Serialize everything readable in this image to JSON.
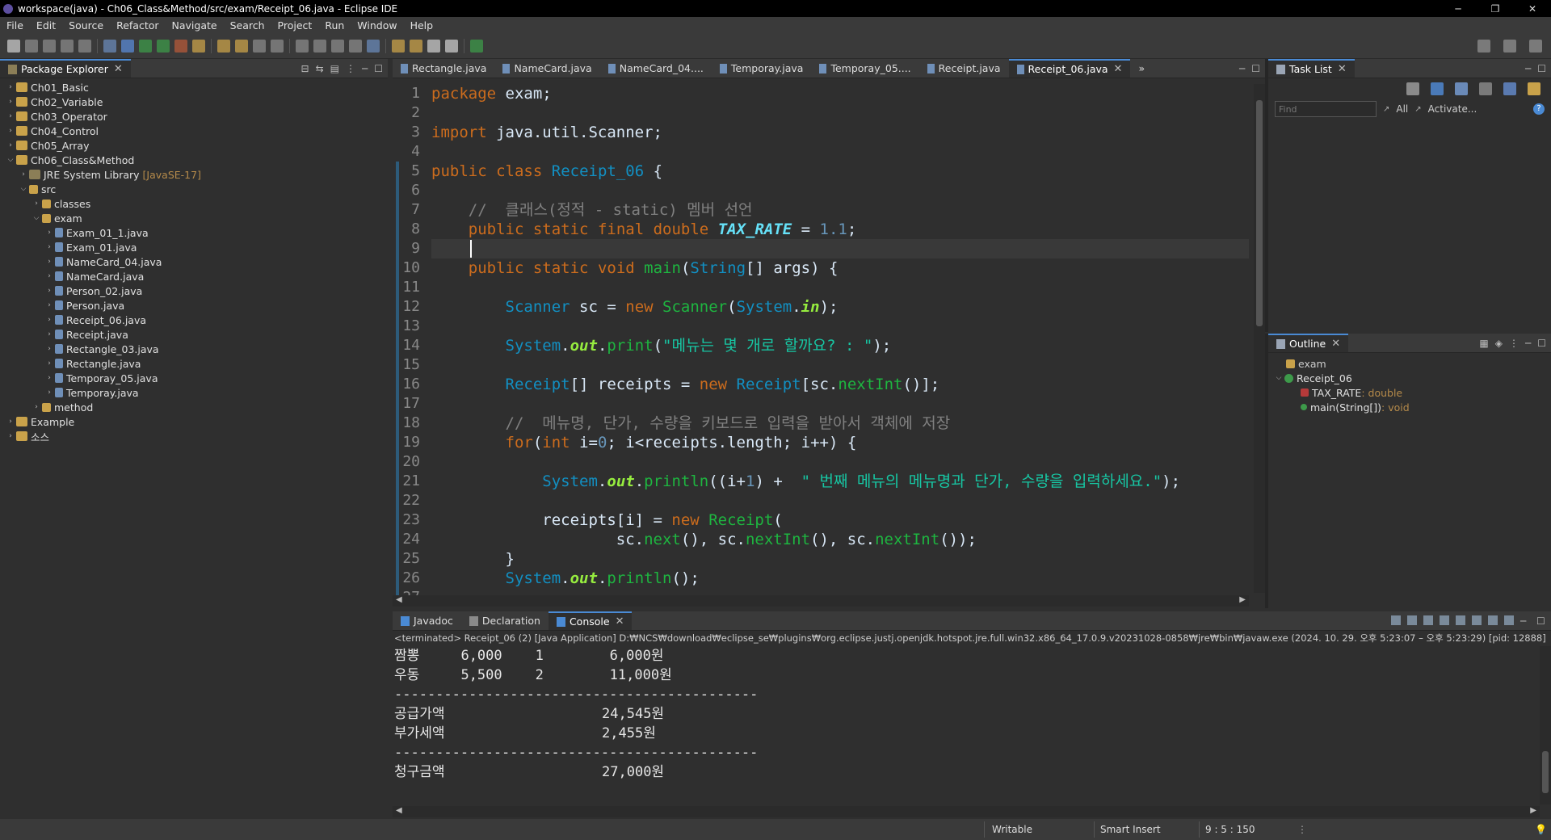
{
  "window": {
    "title": "workspace(java) - Ch06_Class&Method/src/exam/Receipt_06.java - Eclipse IDE",
    "min": "─",
    "max": "❐",
    "close": "✕"
  },
  "menu": [
    "File",
    "Edit",
    "Source",
    "Refactor",
    "Navigate",
    "Search",
    "Project",
    "Run",
    "Window",
    "Help"
  ],
  "package_explorer": {
    "title": "Package Explorer",
    "items": [
      {
        "label": "Ch01_Basic",
        "level": 0,
        "kind": "proj",
        "open": false
      },
      {
        "label": "Ch02_Variable",
        "level": 0,
        "kind": "proj",
        "open": false
      },
      {
        "label": "Ch03_Operator",
        "level": 0,
        "kind": "proj",
        "open": false
      },
      {
        "label": "Ch04_Control",
        "level": 0,
        "kind": "proj",
        "open": false
      },
      {
        "label": "Ch05_Array",
        "level": 0,
        "kind": "proj",
        "open": false
      },
      {
        "label": "Ch06_Class&Method",
        "level": 0,
        "kind": "proj",
        "open": true
      },
      {
        "label": "JRE System Library",
        "extra": "[JavaSE-17]",
        "level": 1,
        "kind": "lib",
        "open": false
      },
      {
        "label": "src",
        "level": 1,
        "kind": "pkg",
        "open": true
      },
      {
        "label": "classes",
        "level": 2,
        "kind": "pkg",
        "open": false
      },
      {
        "label": "exam",
        "level": 2,
        "kind": "pkg",
        "open": true
      },
      {
        "label": "Exam_01_1.java",
        "level": 3,
        "kind": "jfile",
        "open": false
      },
      {
        "label": "Exam_01.java",
        "level": 3,
        "kind": "jfile",
        "open": false
      },
      {
        "label": "NameCard_04.java",
        "level": 3,
        "kind": "jfile",
        "open": false
      },
      {
        "label": "NameCard.java",
        "level": 3,
        "kind": "jfile",
        "open": false
      },
      {
        "label": "Person_02.java",
        "level": 3,
        "kind": "jfile",
        "open": false
      },
      {
        "label": "Person.java",
        "level": 3,
        "kind": "jfile",
        "open": false
      },
      {
        "label": "Receipt_06.java",
        "level": 3,
        "kind": "jfile",
        "open": false
      },
      {
        "label": "Receipt.java",
        "level": 3,
        "kind": "jfile",
        "open": false
      },
      {
        "label": "Rectangle_03.java",
        "level": 3,
        "kind": "jfile",
        "open": false
      },
      {
        "label": "Rectangle.java",
        "level": 3,
        "kind": "jfile",
        "open": false
      },
      {
        "label": "Temporay_05.java",
        "level": 3,
        "kind": "jfile",
        "open": false
      },
      {
        "label": "Temporay.java",
        "level": 3,
        "kind": "jfile",
        "open": false
      },
      {
        "label": "method",
        "level": 2,
        "kind": "pkg",
        "open": false
      },
      {
        "label": "Example",
        "level": 0,
        "kind": "proj",
        "open": false
      },
      {
        "label": "소스",
        "level": 0,
        "kind": "proj",
        "open": false
      }
    ]
  },
  "editor_tabs": [
    "Rectangle.java",
    "NameCard.java",
    "NameCard_04....",
    "Temporay.java",
    "Temporay_05....",
    "Receipt.java",
    "Receipt_06.java"
  ],
  "editor_overflow": "»",
  "task_list": {
    "title": "Task List",
    "find_placeholder": "Find",
    "all": "All",
    "activate": "Activate..."
  },
  "outline": {
    "title": "Outline",
    "pkg": "exam",
    "cls": "Receipt_06",
    "field": "TAX_RATE",
    "field_type": " : double",
    "method": "main(String[])",
    "method_type": " : void"
  },
  "code": [
    [
      [
        "kw",
        "package"
      ],
      [
        "pl",
        " exam;"
      ]
    ],
    [],
    [
      [
        "kw",
        "import"
      ],
      [
        "pl",
        " java.util.Scanner;"
      ]
    ],
    [],
    [
      [
        "kw",
        "public"
      ],
      [
        "pl",
        " "
      ],
      [
        "kw",
        "class"
      ],
      [
        "pl",
        " "
      ],
      [
        "ty",
        "Receipt_06"
      ],
      [
        "pl",
        " {"
      ]
    ],
    [],
    [
      [
        "cm",
        "    //  클래스(정적 - static) 멤버 선언"
      ]
    ],
    [
      [
        "pl",
        "    "
      ],
      [
        "kw",
        "public"
      ],
      [
        "pl",
        " "
      ],
      [
        "kw",
        "static"
      ],
      [
        "pl",
        " "
      ],
      [
        "kw",
        "final"
      ],
      [
        "pl",
        " "
      ],
      [
        "kw",
        "double"
      ],
      [
        "pl",
        " "
      ],
      [
        "fld",
        "TAX_RATE"
      ],
      [
        "pl",
        " = "
      ],
      [
        "num",
        "1.1"
      ],
      [
        "pl",
        ";"
      ]
    ],
    [],
    [
      [
        "pl",
        "    "
      ],
      [
        "kw",
        "public"
      ],
      [
        "pl",
        " "
      ],
      [
        "kw",
        "static"
      ],
      [
        "pl",
        " "
      ],
      [
        "kw",
        "void"
      ],
      [
        "pl",
        " "
      ],
      [
        "mth",
        "main"
      ],
      [
        "pl",
        "("
      ],
      [
        "ty",
        "String"
      ],
      [
        "pl",
        "[] "
      ],
      [
        "pl",
        "args) {"
      ]
    ],
    [],
    [
      [
        "pl",
        "        "
      ],
      [
        "ty",
        "Scanner"
      ],
      [
        "pl",
        " "
      ],
      [
        "pl",
        "sc"
      ],
      [
        "pl",
        " = "
      ],
      [
        "kw",
        "new"
      ],
      [
        "pl",
        " "
      ],
      [
        "mth",
        "Scanner"
      ],
      [
        "pl",
        "("
      ],
      [
        "ty",
        "System"
      ],
      [
        "pl",
        "."
      ],
      [
        "st",
        "in"
      ],
      [
        "pl",
        ");"
      ]
    ],
    [],
    [
      [
        "pl",
        "        "
      ],
      [
        "ty",
        "System"
      ],
      [
        "pl",
        "."
      ],
      [
        "st",
        "out"
      ],
      [
        "pl",
        "."
      ],
      [
        "mth",
        "print"
      ],
      [
        "pl",
        "("
      ],
      [
        "str",
        "\"메뉴는 몇 개로 할까요? : \""
      ],
      [
        "pl",
        ");"
      ]
    ],
    [],
    [
      [
        "pl",
        "        "
      ],
      [
        "ty",
        "Receipt"
      ],
      [
        "pl",
        "[] receipts = "
      ],
      [
        "kw",
        "new"
      ],
      [
        "pl",
        " "
      ],
      [
        "ty",
        "Receipt"
      ],
      [
        "pl",
        "[sc."
      ],
      [
        "mth",
        "nextInt"
      ],
      [
        "pl",
        "()];"
      ]
    ],
    [],
    [
      [
        "cm",
        "        //  메뉴명, 단가, 수량을 키보드로 입력을 받아서 객체에 저장"
      ]
    ],
    [
      [
        "pl",
        "        "
      ],
      [
        "kw",
        "for"
      ],
      [
        "pl",
        "("
      ],
      [
        "kw",
        "int"
      ],
      [
        "pl",
        " i="
      ],
      [
        "num",
        "0"
      ],
      [
        "pl",
        "; i<receipts.length; i++) {"
      ]
    ],
    [],
    [
      [
        "pl",
        "            "
      ],
      [
        "ty",
        "System"
      ],
      [
        "pl",
        "."
      ],
      [
        "st",
        "out"
      ],
      [
        "pl",
        "."
      ],
      [
        "mth",
        "println"
      ],
      [
        "pl",
        "((i+"
      ],
      [
        "num",
        "1"
      ],
      [
        "pl",
        ") +  "
      ],
      [
        "str",
        "\" 번째 메뉴의 메뉴명과 단가, 수량을 입력하세요.\""
      ],
      [
        "pl",
        ");"
      ]
    ],
    [],
    [
      [
        "pl",
        "            receipts[i] = "
      ],
      [
        "kw",
        "new"
      ],
      [
        "pl",
        " "
      ],
      [
        "mth",
        "Receipt"
      ],
      [
        "pl",
        "("
      ]
    ],
    [
      [
        "pl",
        "                    sc."
      ],
      [
        "mth",
        "next"
      ],
      [
        "pl",
        "(), sc."
      ],
      [
        "mth",
        "nextInt"
      ],
      [
        "pl",
        "(), sc."
      ],
      [
        "mth",
        "nextInt"
      ],
      [
        "pl",
        "());"
      ]
    ],
    [
      [
        "pl",
        "        }"
      ]
    ],
    [
      [
        "pl",
        "        "
      ],
      [
        "ty",
        "System"
      ],
      [
        "pl",
        "."
      ],
      [
        "st",
        "out"
      ],
      [
        "pl",
        "."
      ],
      [
        "mth",
        "println"
      ],
      [
        "pl",
        "();"
      ]
    ],
    []
  ],
  "line_numbers": [
    "1",
    "2",
    "3",
    "4",
    "5",
    "6",
    "7",
    "8",
    "9",
    "10",
    "11",
    "12",
    "13",
    "14",
    "15",
    "16",
    "17",
    "18",
    "19",
    "20",
    "21",
    "22",
    "23",
    "24",
    "25",
    "26",
    "27"
  ],
  "console": {
    "tabs": [
      "Javadoc",
      "Declaration",
      "Console"
    ],
    "header": "<terminated> Receipt_06 (2) [Java Application] D:₩NCS₩download₩eclipse_se₩plugins₩org.eclipse.justj.openjdk.hotspot.jre.full.win32.x86_64_17.0.9.v20231028-0858₩jre₩bin₩javaw.exe  (2024. 10. 29. 오후 5:23:07 – 오후 5:23:29) [pid: 12888]",
    "lines": [
      "짬뽕     6,000    1        6,000원",
      "우동     5,500    2        11,000원",
      "--------------------------------------------",
      "공급가액                   24,545원",
      "부가세액                   2,455원",
      "--------------------------------------------",
      "청구금액                   27,000원"
    ]
  },
  "status": {
    "writable": "Writable",
    "insert": "Smart Insert",
    "position": "9 : 5 : 150"
  }
}
